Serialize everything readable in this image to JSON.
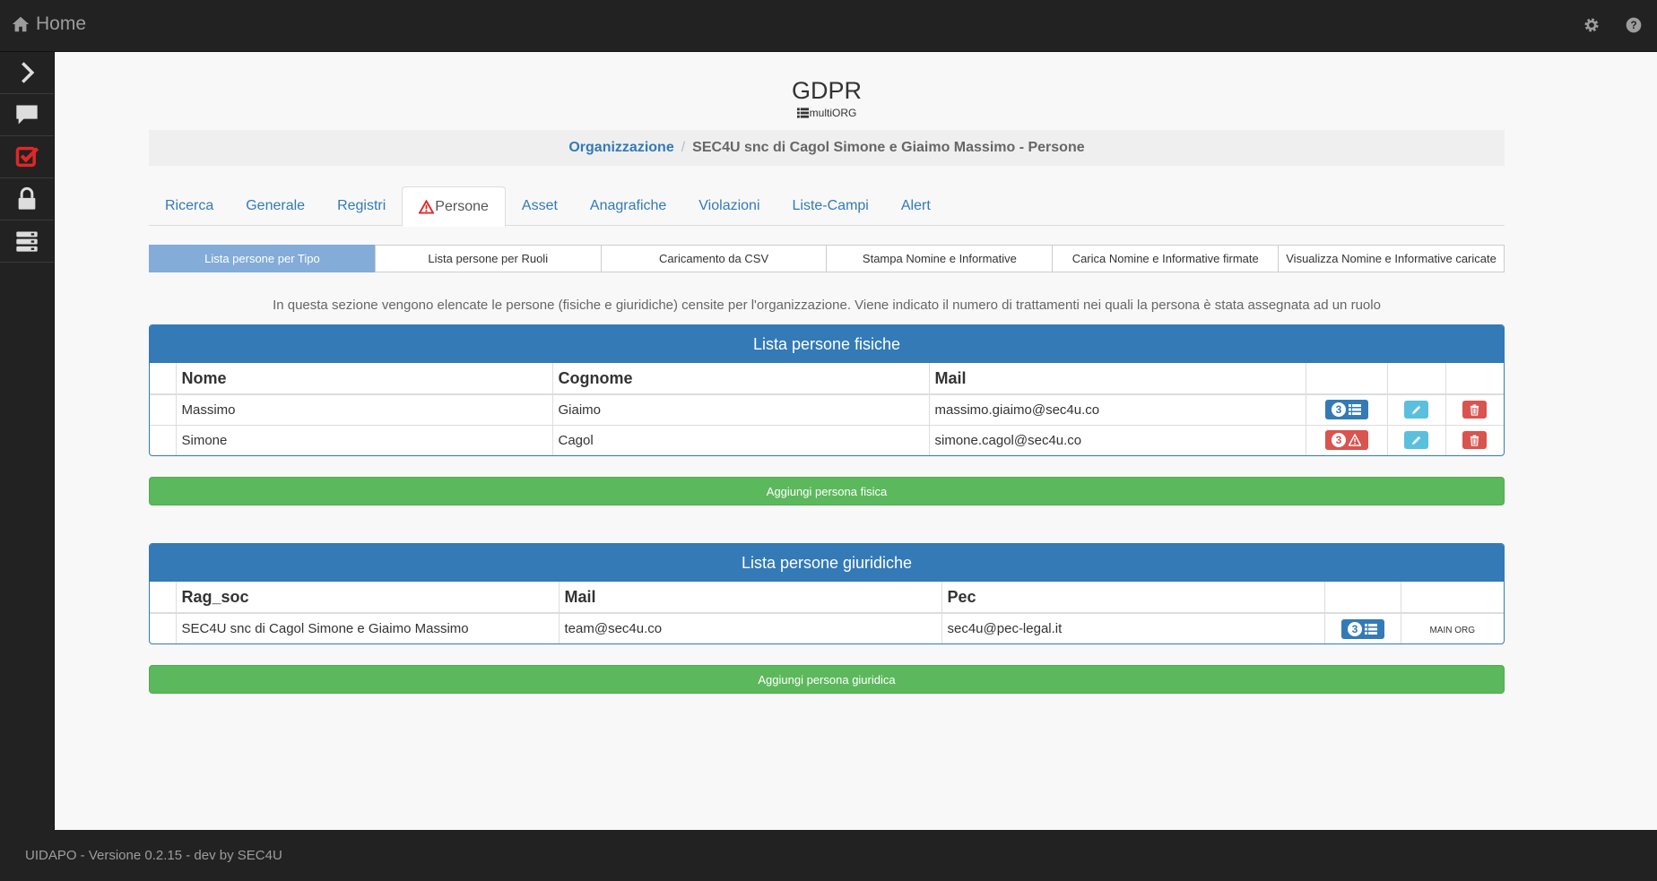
{
  "topbar": {
    "home_label": "Home",
    "icons": [
      "home-icon",
      "gear-icon",
      "help-icon"
    ]
  },
  "sidebar": {
    "items": [
      "chevron-right-icon",
      "comment-icon",
      "check-square-icon",
      "lock-icon",
      "server-icon"
    ]
  },
  "header": {
    "title": "GDPR",
    "subtitle": "multiORG"
  },
  "breadcrumb": {
    "link": "Organizzazione",
    "separator": "/",
    "current": "SEC4U snc di Cagol Simone e Giaimo Massimo - Persone"
  },
  "tabs": [
    {
      "label": "Ricerca"
    },
    {
      "label": "Generale"
    },
    {
      "label": "Registri"
    },
    {
      "label": "Persone",
      "active": true
    },
    {
      "label": "Asset"
    },
    {
      "label": "Anagrafiche"
    },
    {
      "label": "Violazioni"
    },
    {
      "label": "Liste-Campi"
    },
    {
      "label": "Alert"
    }
  ],
  "subtabs": [
    {
      "label": "Lista persone per Tipo",
      "active": true
    },
    {
      "label": "Lista persone per Ruoli"
    },
    {
      "label": "Caricamento da CSV"
    },
    {
      "label": "Stampa Nomine e Informative"
    },
    {
      "label": "Carica Nomine e Informative firmate"
    },
    {
      "label": "Visualizza Nomine e Informative caricate"
    }
  ],
  "description": "In questa sezione vengono elencate le persone (fisiche e giuridiche) censite per l'organizzazione. Viene indicato il numero di trattamenti nei quali la persona è stata assegnata ad un ruolo",
  "fisiche": {
    "title": "Lista persone fisiche",
    "columns": [
      "Nome",
      "Cognome",
      "Mail"
    ],
    "rows": [
      {
        "nome": "Massimo",
        "cognome": "Giaimo",
        "mail": "massimo.giaimo@sec4u.co",
        "count": "3",
        "status": "ok"
      },
      {
        "nome": "Simone",
        "cognome": "Cagol",
        "mail": "simone.cagol@sec4u.co",
        "count": "3",
        "status": "warning"
      }
    ],
    "add_label": "Aggiungi persona fisica"
  },
  "giuridiche": {
    "title": "Lista persone giuridiche",
    "columns": [
      "Rag_soc",
      "Mail",
      "Pec"
    ],
    "rows": [
      {
        "rag_soc": "SEC4U snc di Cagol Simone e Giaimo Massimo",
        "mail": "team@sec4u.co",
        "pec": "sec4u@pec-legal.it",
        "count": "3",
        "tag": "MAIN ORG"
      }
    ],
    "add_label": "Aggiungi persona giuridica"
  },
  "footer": {
    "text": "UIDAPO - Versione 0.2.15 - dev by SEC4U"
  },
  "colors": {
    "primary": "#337ab7",
    "success": "#5cb85c",
    "danger": "#d9534f",
    "info": "#5bc0de",
    "dark": "#222222",
    "subtab_active": "#83acd8"
  }
}
